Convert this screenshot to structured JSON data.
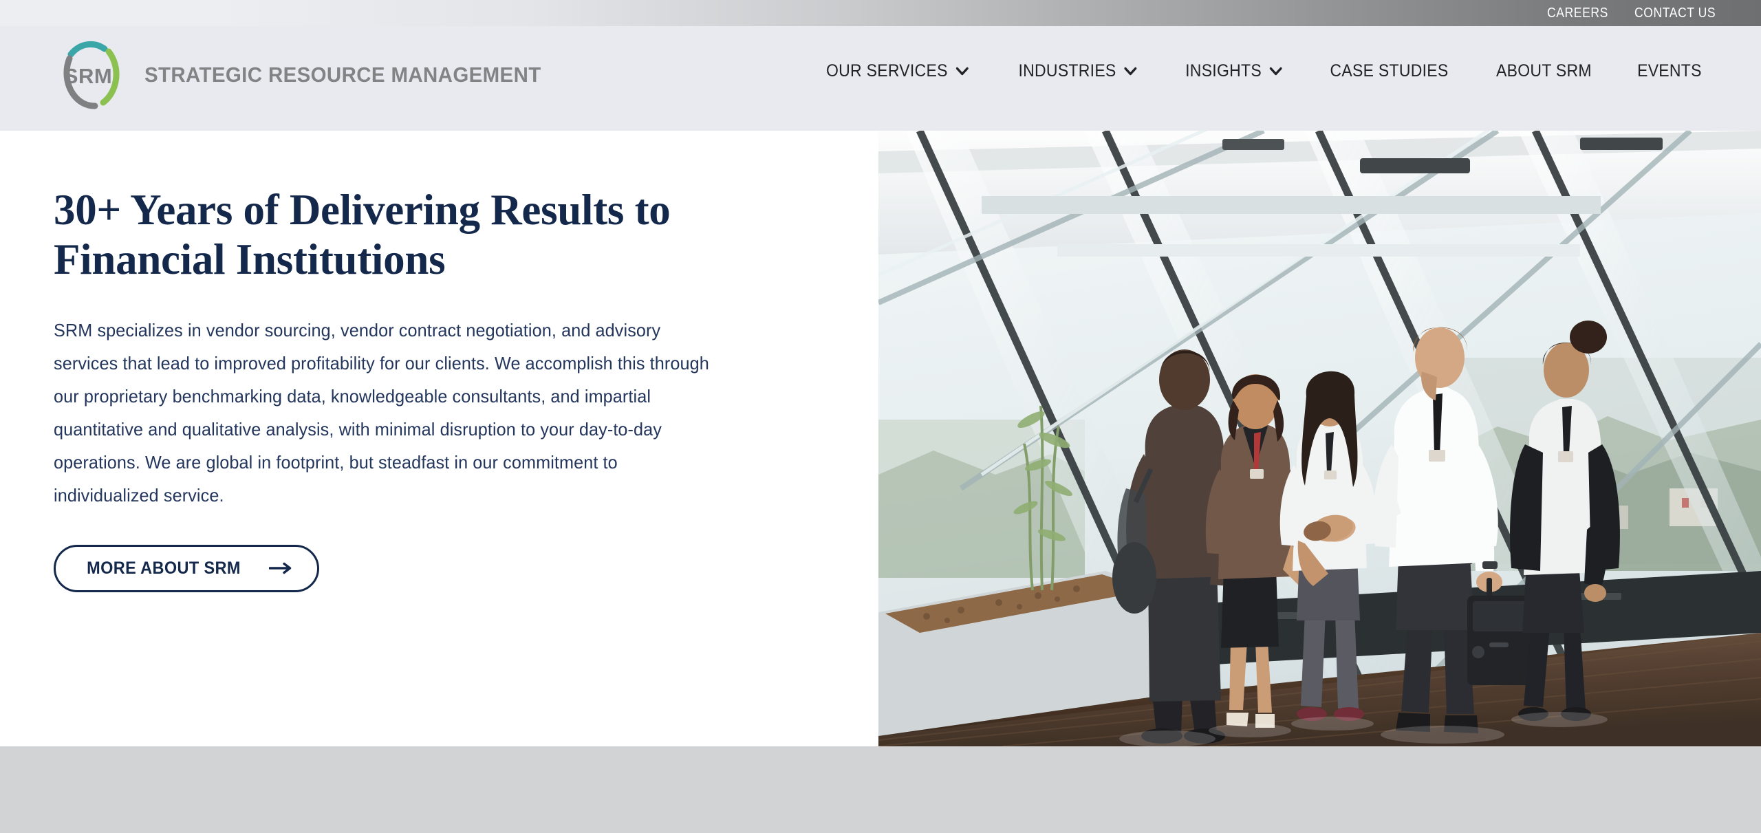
{
  "topbar": {
    "links": [
      {
        "label": "CAREERS",
        "name": "careers-link"
      },
      {
        "label": "CONTACT US",
        "name": "contact-us-link"
      }
    ]
  },
  "header": {
    "logo": {
      "mark_text": "SRM",
      "wordmark": "STRATEGIC RESOURCE MANAGEMENT",
      "colors": {
        "teal_arc": "#3aa6a8",
        "green_arc": "#8cc152",
        "gray_arc": "#7f8082",
        "mark_text_color": "#7f8082",
        "wordmark_color": "#828385"
      }
    },
    "nav": [
      {
        "label": "OUR SERVICES",
        "has_dropdown": true
      },
      {
        "label": "INDUSTRIES",
        "has_dropdown": true
      },
      {
        "label": "INSIGHTS",
        "has_dropdown": true
      },
      {
        "label": "CASE STUDIES",
        "has_dropdown": false
      },
      {
        "label": "ABOUT SRM",
        "has_dropdown": false
      },
      {
        "label": "EVENTS",
        "has_dropdown": false
      }
    ],
    "background_color": "#e9eaef"
  },
  "hero": {
    "title_line1": "30+ Years of Delivering Results to",
    "title_line2": "Financial Institutions",
    "body": "SRM specializes in vendor sourcing, vendor contract negotiation, and advisory services that lead to improved profitability for our clients. We accomplish this through our proprietary benchmarking data, knowledgeable consultants, and impartial quantitative and qualitative analysis, with minimal disruption to your day-to-day operations. We are global in footprint, but steadfast in our commitment to individualized service.",
    "cta_label": "MORE ABOUT SRM",
    "cta_icon": "arrow-right-icon",
    "title_color": "#14284b",
    "body_color": "#24365c",
    "accent_color": "#14284b",
    "image_alt": "Five business professionals shaking hands in a modern glass atrium with wood floor"
  },
  "below": {
    "background_color": "#d2d3d4"
  }
}
